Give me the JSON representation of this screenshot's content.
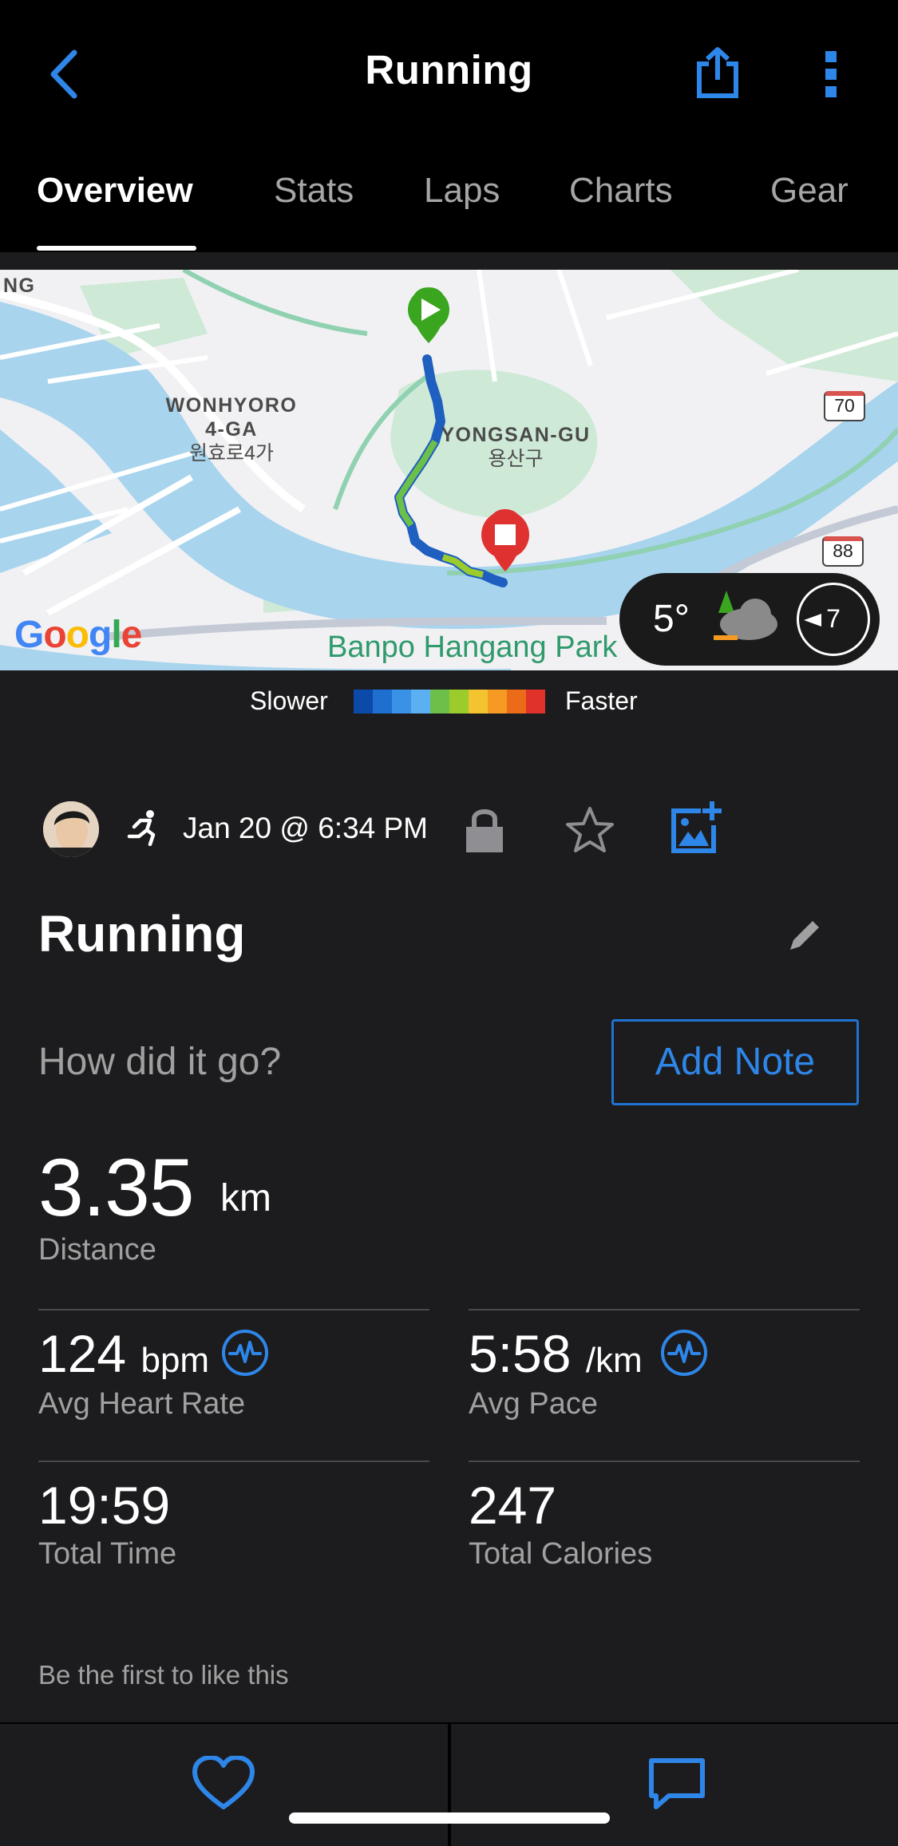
{
  "header": {
    "title": "Running",
    "back_icon": "chevron-left-icon",
    "share_icon": "share-icon",
    "more_icon": "more-vertical-icon"
  },
  "tabs": [
    {
      "label": "Overview",
      "active": true
    },
    {
      "label": "Stats",
      "active": false
    },
    {
      "label": "Laps",
      "active": false
    },
    {
      "label": "Charts",
      "active": false
    },
    {
      "label": "Gear",
      "active": false
    }
  ],
  "map": {
    "labels": {
      "wonhyoro_en_1": "WONHYORO",
      "wonhyoro_en_2": "4-GA",
      "wonhyoro_ko": "원효로4가",
      "yongsan_en": "YONGSAN-GU",
      "yongsan_ko": "용산구",
      "edge_fragment": "NG",
      "park": "Banpo Hangang Park",
      "google": "Google",
      "route_70": "70",
      "route_88": "88"
    },
    "weather": {
      "temperature": "5°",
      "wind_speed": "7",
      "icon": "cloudy-night-icon"
    }
  },
  "pace_legend": {
    "slow_label": "Slower",
    "fast_label": "Faster",
    "colors": [
      "#0b4aa8",
      "#1f6fd1",
      "#3a92e6",
      "#5ab0f0",
      "#6cc04a",
      "#9ccc2c",
      "#f4c430",
      "#f59a23",
      "#ec6b18",
      "#e0312a"
    ]
  },
  "activity": {
    "date": "Jan 20 @ 6:34 PM",
    "title": "Running",
    "prompt": "How did it go?",
    "add_note_label": "Add Note",
    "accent_color": "#2e86e8"
  },
  "stats": {
    "distance": {
      "value": "3.35",
      "unit": "km",
      "label": "Distance"
    },
    "heart_rate": {
      "value": "124",
      "unit": "bpm",
      "label": "Avg Heart Rate"
    },
    "pace": {
      "value": "5:58",
      "unit": "/km",
      "label": "Avg Pace"
    },
    "time": {
      "value": "19:59",
      "label": "Total Time"
    },
    "calories": {
      "value": "247",
      "label": "Total Calories"
    }
  },
  "social": {
    "likes_text": "Be the first to like this"
  }
}
